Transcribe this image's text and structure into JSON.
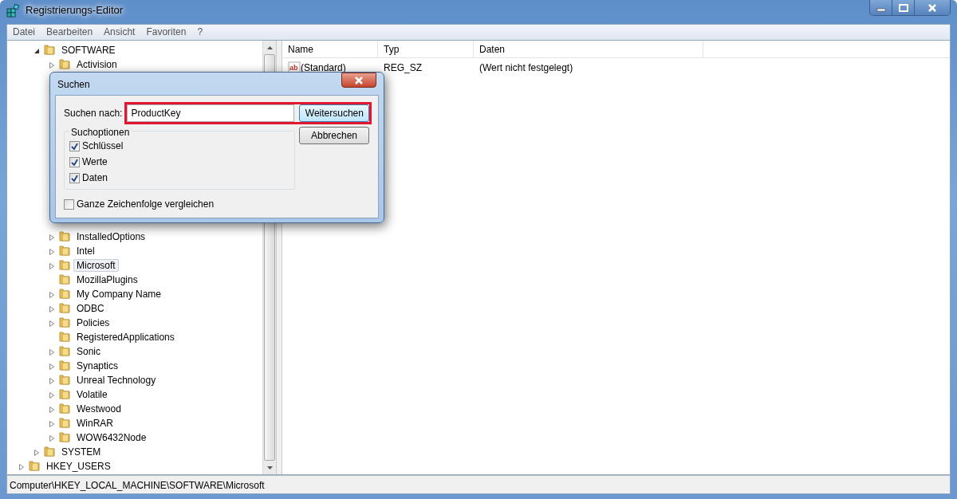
{
  "window": {
    "title": "Registrierungs-Editor"
  },
  "menu": [
    "Datei",
    "Bearbeiten",
    "Ansicht",
    "Favoriten",
    "?"
  ],
  "tree": [
    {
      "children": [
        {
          "label": "SOFTWARE",
          "expandable": true,
          "expanded": true,
          "selected": false,
          "children": [
            {
              "label": "Activision",
              "expandable": true,
              "expanded": false,
              "selected": false
            },
            {
              "label": "InstalledOptions",
              "expandable": true,
              "expanded": false,
              "selected": false
            },
            {
              "label": "Intel",
              "expandable": true,
              "expanded": false,
              "selected": false
            },
            {
              "label": "Microsoft",
              "expandable": true,
              "expanded": false,
              "selected": true
            },
            {
              "label": "MozillaPlugins",
              "expandable": false,
              "selected": false
            },
            {
              "label": "My Company Name",
              "expandable": true,
              "expanded": false,
              "selected": false
            },
            {
              "label": "ODBC",
              "expandable": true,
              "expanded": false,
              "selected": false
            },
            {
              "label": "Policies",
              "expandable": true,
              "expanded": false,
              "selected": false
            },
            {
              "label": "RegisteredApplications",
              "expandable": false,
              "selected": false
            },
            {
              "label": "Sonic",
              "expandable": true,
              "expanded": false,
              "selected": false
            },
            {
              "label": "Synaptics",
              "expandable": true,
              "expanded": false,
              "selected": false
            },
            {
              "label": "Unreal Technology",
              "expandable": true,
              "expanded": false,
              "selected": false
            },
            {
              "label": "Volatile",
              "expandable": true,
              "expanded": false,
              "selected": false
            },
            {
              "label": "Westwood",
              "expandable": true,
              "expanded": false,
              "selected": false
            },
            {
              "label": "WinRAR",
              "expandable": true,
              "expanded": false,
              "selected": false
            },
            {
              "label": "WOW6432Node",
              "expandable": true,
              "expanded": false,
              "selected": false
            }
          ]
        },
        {
          "label": "SYSTEM",
          "expandable": true,
          "expanded": false,
          "selected": false
        }
      ]
    },
    {
      "label": "HKEY_USERS",
      "expandable": true,
      "expanded": false,
      "selected": false
    }
  ],
  "values": {
    "columns": [
      "Name",
      "Typ",
      "Daten"
    ],
    "rows": [
      {
        "icon_text": "ab",
        "name": "(Standard)",
        "type": "REG_SZ",
        "data": "(Wert nicht festgelegt)"
      }
    ]
  },
  "status_bar": "Computer\\HKEY_LOCAL_MACHINE\\SOFTWARE\\Microsoft",
  "dialog": {
    "title": "Suchen",
    "search_label": "Suchen nach:",
    "search_value": "ProductKey",
    "options_title": "Suchoptionen",
    "options": [
      {
        "label": "Schlüssel",
        "checked": true
      },
      {
        "label": "Werte",
        "checked": true
      },
      {
        "label": "Daten",
        "checked": true
      }
    ],
    "whole_string": {
      "label": "Ganze Zeichenfolge vergleichen",
      "checked": false
    },
    "buttons": [
      "Weitersuchen",
      "Abbrechen"
    ]
  }
}
